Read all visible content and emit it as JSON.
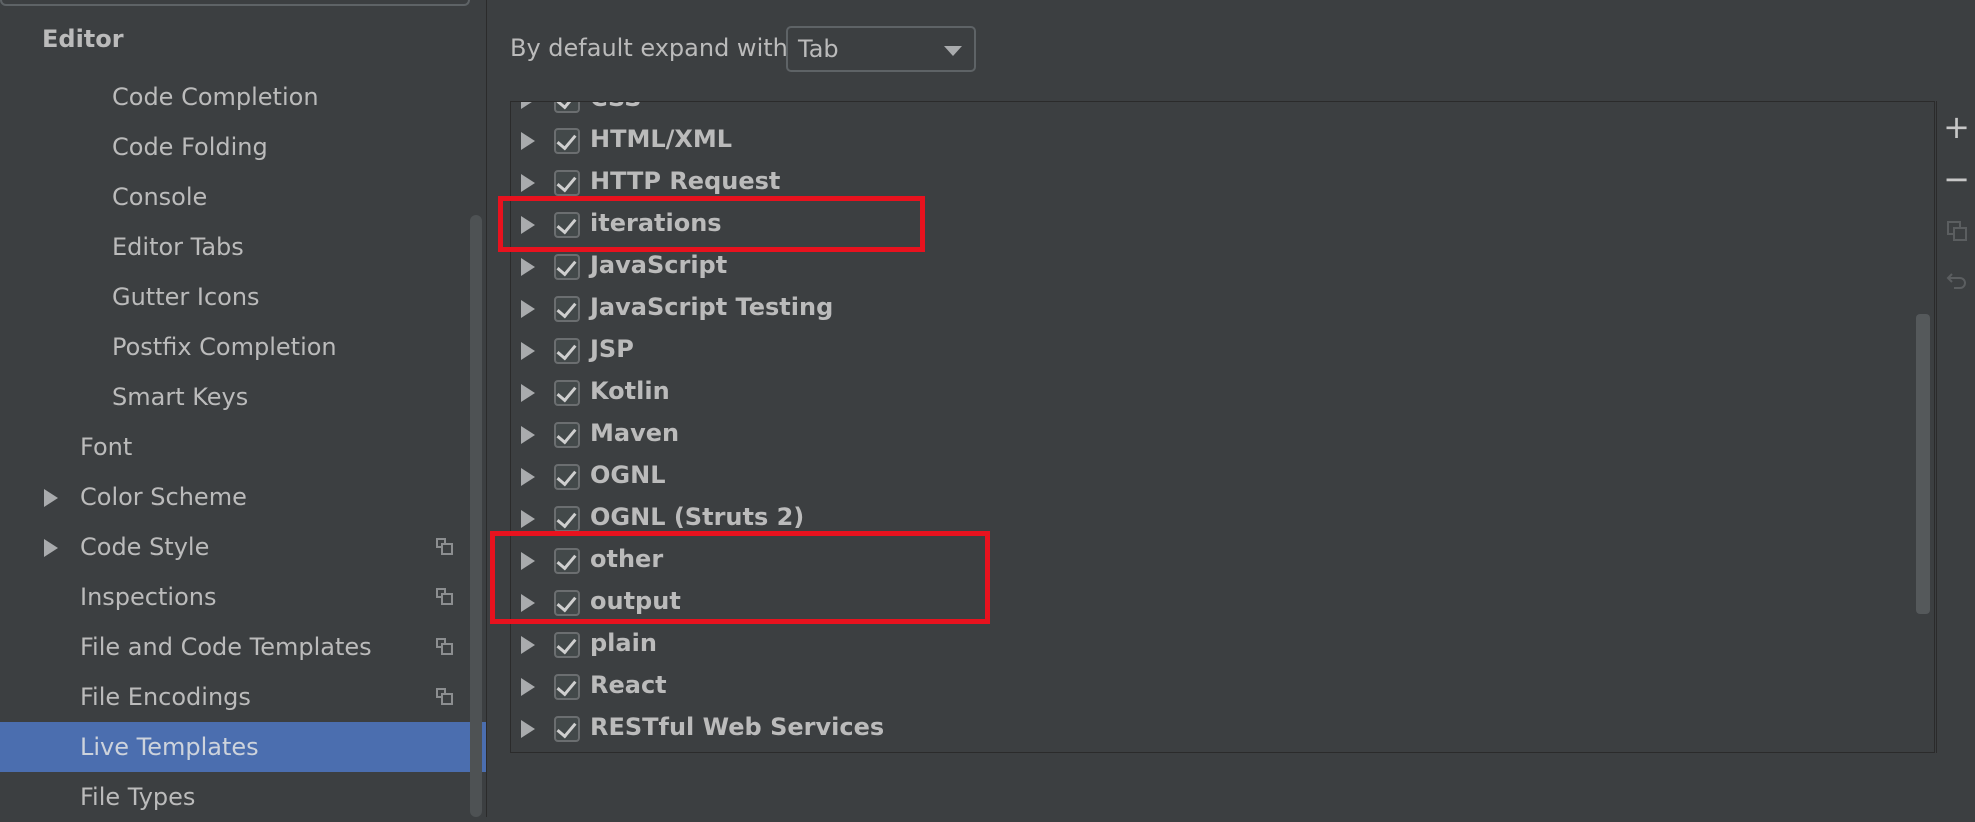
{
  "sidebar": {
    "section_title": "Editor",
    "items": [
      {
        "label": "Code Completion"
      },
      {
        "label": "Code Folding"
      },
      {
        "label": "Console"
      },
      {
        "label": "Editor Tabs"
      },
      {
        "label": "Gutter Icons"
      },
      {
        "label": "Postfix Completion"
      },
      {
        "label": "Smart Keys"
      },
      {
        "label": "Font"
      },
      {
        "label": "Color Scheme"
      },
      {
        "label": "Code Style"
      },
      {
        "label": "Inspections"
      },
      {
        "label": "File and Code Templates"
      },
      {
        "label": "File Encodings"
      },
      {
        "label": "Live Templates"
      },
      {
        "label": "File Types"
      }
    ]
  },
  "main": {
    "expand_label": "By default expand with",
    "expand_value": "Tab",
    "groups": [
      {
        "label": "CSS"
      },
      {
        "label": "HTML/XML"
      },
      {
        "label": "HTTP Request"
      },
      {
        "label": "iterations"
      },
      {
        "label": "JavaScript"
      },
      {
        "label": "JavaScript Testing"
      },
      {
        "label": "JSP"
      },
      {
        "label": "Kotlin"
      },
      {
        "label": "Maven"
      },
      {
        "label": "OGNL"
      },
      {
        "label": "OGNL (Struts 2)"
      },
      {
        "label": "other"
      },
      {
        "label": "output"
      },
      {
        "label": "plain"
      },
      {
        "label": "React"
      },
      {
        "label": "RESTful Web Services"
      }
    ],
    "toolbar": {
      "add_symbol": "+",
      "remove_symbol": "−"
    }
  },
  "colors": {
    "background": "#3c3f41",
    "selection": "#4b6eaf",
    "highlight": "#e8121e"
  }
}
